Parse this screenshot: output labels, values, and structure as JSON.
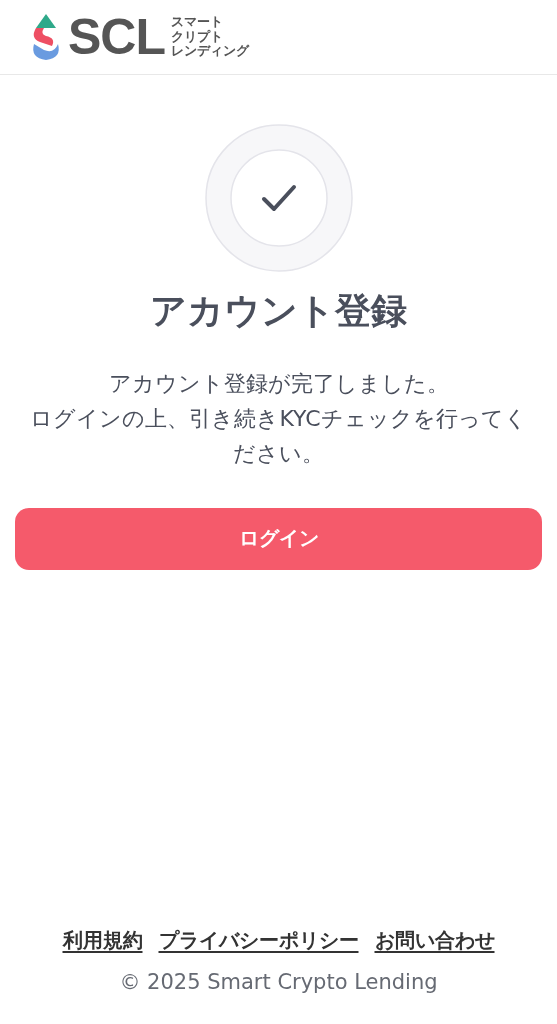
{
  "header": {
    "logo": {
      "text": "SCL",
      "tagline": [
        "スマート",
        "クリプト",
        "レンディング"
      ]
    }
  },
  "status": {
    "title": "アカウント登録",
    "message": [
      "アカウント登録が完了しました。",
      "ログインの上、引き続きKYCチェックを行ってください。"
    ]
  },
  "login_button": "ログイン",
  "footer": {
    "links": [
      "利用規約",
      "プライバシーポリシー",
      "お問い合わせ"
    ],
    "copyright": "© 2025 Smart Crypto Lending"
  }
}
